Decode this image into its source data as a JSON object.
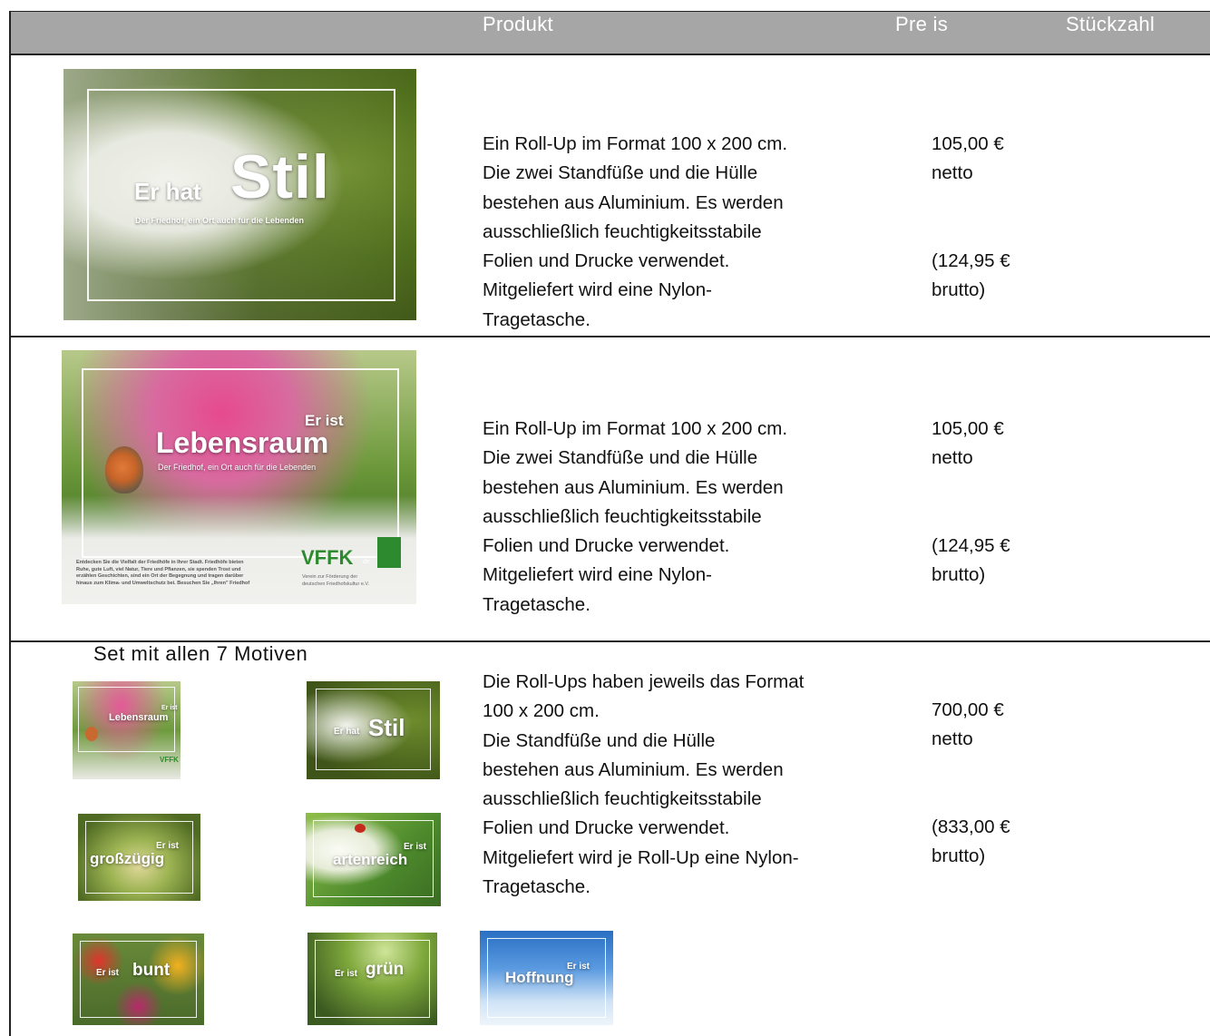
{
  "header": {
    "col_product": "Produkt",
    "col_price": "Pre is",
    "col_quantity": "Stückzahl"
  },
  "rows": [
    {
      "poster": {
        "small_word": "Er hat",
        "big_word": "Stil",
        "subtitle": "Der Friedhof, ein Ort auch für die Lebenden"
      },
      "description": [
        "Ein Roll-Up im Format 100 x 200 cm.",
        "Die zwei Standfüße und die Hülle",
        "bestehen aus Aluminium. Es werden",
        "ausschließlich feuchtigkeitsstabile",
        "Folien und Drucke verwendet.",
        "Mitgeliefert wird eine Nylon-",
        "Tragetasche."
      ],
      "price_net": [
        "105,00 €",
        "netto"
      ],
      "price_gross": [
        "(124,95 €",
        "brutto)"
      ]
    },
    {
      "poster": {
        "small_word": "Er ist",
        "big_word": "Lebensraum",
        "subtitle": "Der Friedhof, ein Ort auch für die Lebenden",
        "body_text": [
          "Entdecken Sie die Vielfalt der Friedhöfe in Ihrer Stadt. Friedhöfe bieten",
          "Ruhe, gute Luft, viel Natur, Tiere und Pflanzen, sie spenden Trost und",
          "erzählen Geschichten, sind ein Ort der Begegnung und tragen darüber",
          "hinaus zum Klima- und Umweltschutz bei. Besuchen Sie „Ihren\" Friedhof"
        ],
        "logo": "VFFK",
        "logo_suffix": ".de",
        "logo_caption": [
          "Verein zur Förderung der",
          "deutschen Friedhofskultur e.V."
        ]
      },
      "description": [
        "Ein Roll-Up im Format 100 x 200 cm.",
        "Die zwei Standfüße und die Hülle",
        "bestehen aus Aluminium. Es werden",
        "ausschließlich feuchtigkeitsstabile",
        "Folien und Drucke verwendet.",
        "Mitgeliefert wird eine Nylon-",
        "Tragetasche."
      ],
      "price_net": [
        "105,00 €",
        "netto"
      ],
      "price_gross": [
        "(124,95 €",
        "brutto)"
      ]
    },
    {
      "set_title": "Set mit allen 7 Motiven",
      "thumbnails": [
        {
          "small": "Er ist",
          "big": "Lebensraum",
          "logo": "VFFK"
        },
        {
          "small": "Er hat",
          "big": "Stil"
        },
        {
          "small": "Er ist",
          "big": "großzügig"
        },
        {
          "small": "Er ist",
          "big": "artenreich"
        },
        {
          "small": "Er ist",
          "big": "bunt"
        },
        {
          "small": "Er ist",
          "big": "grün"
        },
        {
          "small": "Er ist",
          "big": "Hoffnung"
        }
      ],
      "description": [
        "Die Roll-Ups haben jeweils das Format",
        "100 x 200 cm.",
        "Die Standfüße und die Hülle",
        "bestehen aus Aluminium. Es werden",
        "ausschließlich feuchtigkeitsstabile",
        "Folien und Drucke verwendet.",
        "Mitgeliefert wird je Roll-Up eine Nylon-",
        "Tragetasche."
      ],
      "price_net": [
        "700,00 €",
        "netto"
      ],
      "price_gross": [
        "(833,00 €",
        "brutto)"
      ]
    }
  ],
  "colors": {
    "header_bg": "#a6a6a6",
    "border": "#222222"
  }
}
